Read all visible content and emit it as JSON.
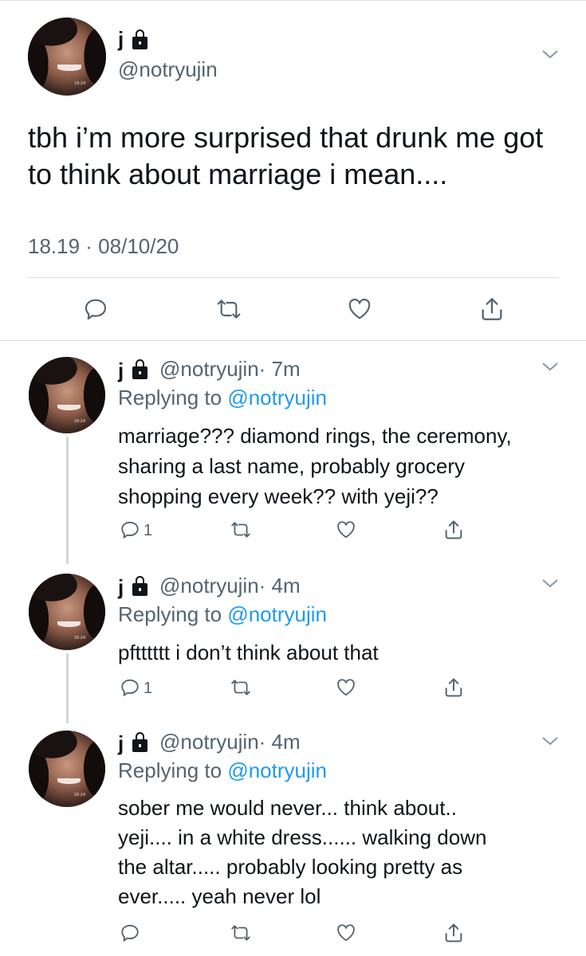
{
  "main_tweet": {
    "name": "j",
    "handle": "@notryujin",
    "text": "tbh i’m more surprised that drunk me got to think about marriage i mean....",
    "meta": "18.19 · 08/10/20"
  },
  "replies": [
    {
      "name": "j",
      "handle": "@notryujin",
      "time": "· 7m",
      "replying_prefix": "Replying to ",
      "replying_handle": "@notryujin",
      "text": "marriage??? diamond rings, the ceremony,\nsharing a last name, probably grocery\nshopping every week?? with yeji??",
      "reply_count": "1"
    },
    {
      "name": "j",
      "handle": "@notryujin",
      "time": "· 4m",
      "replying_prefix": "Replying to ",
      "replying_handle": "@notryujin",
      "text": "pftttttt i don’t think about that",
      "reply_count": "1"
    },
    {
      "name": "j",
      "handle": "@notryujin",
      "time": "· 4m",
      "replying_prefix": "Replying to ",
      "replying_handle": "@notryujin",
      "text": "sober me would never... think about..\nyeji.... in a white dress...... walking down\nthe altar..... probably looking pretty as\never..... yeah never lol",
      "reply_count": ""
    }
  ],
  "icons": [
    "chevron-down-icon",
    "lock-icon",
    "reply-icon",
    "retweet-icon",
    "like-icon",
    "share-icon"
  ],
  "colors": {
    "link": "#1d9bf0",
    "secondary": "#536471",
    "divider": "#d8dde0"
  }
}
